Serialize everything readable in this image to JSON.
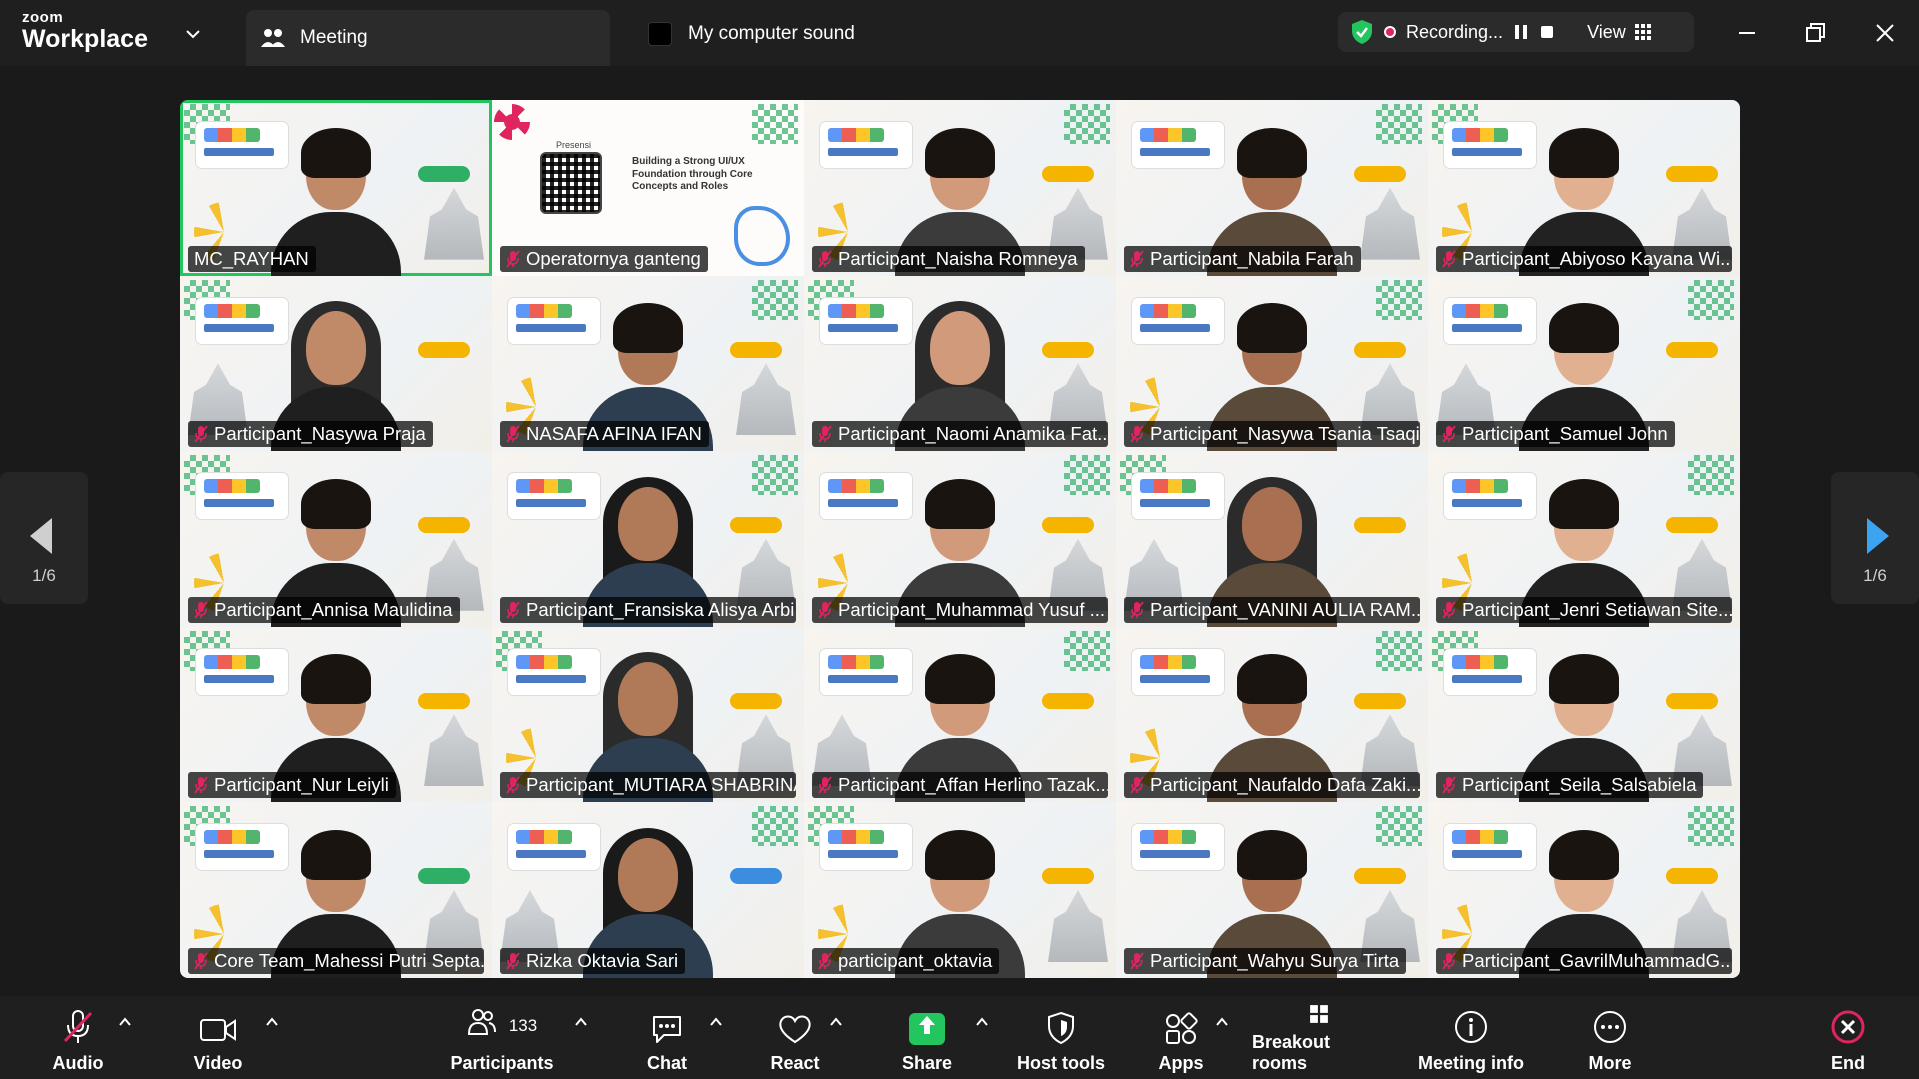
{
  "brand": {
    "small": "zoom",
    "big": "Workplace"
  },
  "meeting_tab": {
    "label": "Meeting"
  },
  "computer_sound": {
    "label": "My computer sound"
  },
  "recording": {
    "label": "Recording...",
    "view_label": "View"
  },
  "pager": {
    "left": "1/6",
    "right": "1/6"
  },
  "participants": [
    {
      "name": "MC_RAYHAN",
      "muted": false,
      "active": true
    },
    {
      "name": "Operatornya ganteng",
      "muted": true,
      "screen": true
    },
    {
      "name": "Participant_Naisha Romneya",
      "muted": true
    },
    {
      "name": "Participant_Nabila Farah",
      "muted": true
    },
    {
      "name": "Participant_Abiyoso Kayana Wi...",
      "muted": true
    },
    {
      "name": "Participant_Nasywa Praja",
      "muted": true
    },
    {
      "name": "NASAFA AFINA IFAN",
      "muted": true
    },
    {
      "name": "Participant_Naomi Anamika Fat...",
      "muted": true
    },
    {
      "name": "Participant_Nasywa Tsania Tsaqif",
      "muted": true
    },
    {
      "name": "Participant_Samuel John",
      "muted": true
    },
    {
      "name": "Participant_Annisa Maulidina",
      "muted": true
    },
    {
      "name": "Participant_Fransiska Alisya Arbi",
      "muted": true
    },
    {
      "name": "Participant_Muhammad Yusuf ...",
      "muted": true
    },
    {
      "name": "Participant_VANINI AULIA RAM...",
      "muted": true
    },
    {
      "name": "Participant_Jenri Setiawan Site...",
      "muted": true
    },
    {
      "name": "Participant_Nur Leiyli",
      "muted": true
    },
    {
      "name": "Participant_MUTIARA SHABRINA",
      "muted": true
    },
    {
      "name": "Participant_Affan Herlino Tazak...",
      "muted": true
    },
    {
      "name": "Participant_Naufaldo Dafa Zaki...",
      "muted": true
    },
    {
      "name": "Participant_Seila_Salsabiela",
      "muted": true
    },
    {
      "name": "Core Team_Mahessi Putri Septa...",
      "muted": true
    },
    {
      "name": "Rizka Oktavia Sari",
      "muted": true
    },
    {
      "name": "participant_oktavia",
      "muted": true
    },
    {
      "name": "Participant_Wahyu Surya Tirta",
      "muted": true
    },
    {
      "name": "Participant_GavrilMuhammadG...",
      "muted": true
    }
  ],
  "screen_share": {
    "presensi": "Presensi",
    "title": "Building a Strong UI/UX Foundation through Core Concepts and Roles"
  },
  "toolbar": {
    "audio": "Audio",
    "video": "Video",
    "participants": "Participants",
    "participants_count": "133",
    "chat": "Chat",
    "react": "React",
    "share": "Share",
    "host_tools": "Host tools",
    "apps": "Apps",
    "breakout_rooms": "Breakout rooms",
    "meeting_info": "Meeting info",
    "more": "More",
    "end": "End"
  },
  "colors": {
    "accent_green": "#22c55e",
    "end_red": "#e0245e",
    "pager_blue": "#3ba3f0"
  }
}
